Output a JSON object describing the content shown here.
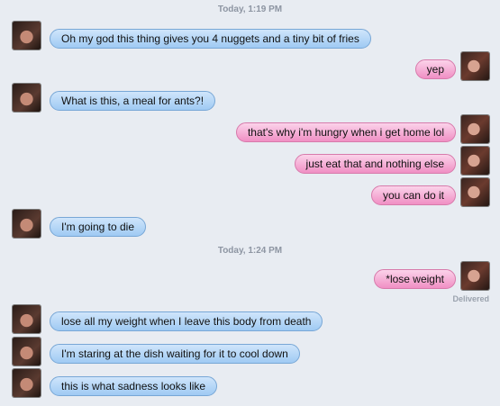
{
  "timestamps": [
    "Today, 1:19 PM",
    "Today, 1:24 PM"
  ],
  "messages": [
    {
      "side": "left",
      "text": "Oh my god this thing gives you 4 nuggets and a tiny bit of fries"
    },
    {
      "side": "right",
      "text": "yep"
    },
    {
      "side": "left",
      "text": "What is this, a meal for ants?!"
    },
    {
      "side": "right",
      "text": "that's why i'm hungry when i get home lol"
    },
    {
      "side": "right",
      "text": "just eat that and nothing else"
    },
    {
      "side": "right",
      "text": "you can do it"
    },
    {
      "side": "left",
      "text": "I'm going to die"
    },
    {
      "side": "right",
      "text": "*lose weight"
    },
    {
      "side": "left",
      "text": "lose all my weight when I leave this body from death"
    },
    {
      "side": "left",
      "text": "I'm staring at the dish waiting for it to cool down"
    },
    {
      "side": "left",
      "text": "this is what sadness looks like"
    }
  ],
  "status": "Delivered",
  "colors": {
    "left_bubble": "#a9d1f6",
    "right_bubble": "#f4a6d2",
    "background": "#e8ecf2"
  }
}
